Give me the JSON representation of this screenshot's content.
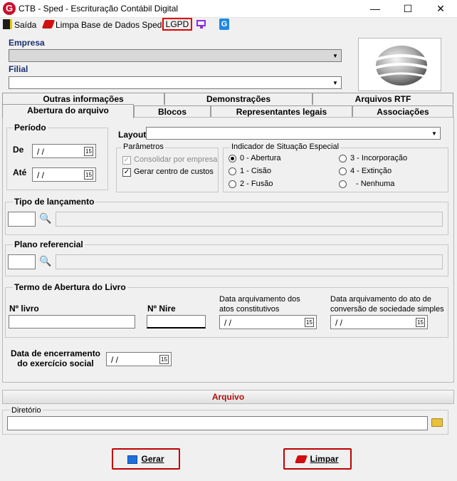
{
  "window": {
    "title": "CTB - Sped - Escrituração Contábil Digital",
    "app_icon": "G",
    "minimize": "—",
    "maximize": "☐",
    "close": "✕"
  },
  "toolbar": {
    "exit_label": "Saída",
    "clear_db_label": "Limpa Base de Dados Sped",
    "lgpd_label": "LGPD"
  },
  "company": {
    "empresa_label": "Empresa",
    "empresa_value": "",
    "filial_label": "Filial",
    "filial_value": ""
  },
  "tabs": {
    "row1": [
      "Outras informações",
      "Demonstrações",
      "Arquivos RTF"
    ],
    "row2": [
      "Abertura do arquivo",
      "Blocos",
      "Representantes legais",
      "Associações"
    ],
    "active": "Abertura do arquivo"
  },
  "periodo": {
    "title": "Período",
    "de_label": "De",
    "de_value": "/ /",
    "ate_label": "Até",
    "ate_value": "/ /"
  },
  "layout": {
    "label": "Layout",
    "value": ""
  },
  "parametros": {
    "title": "Parâmetros",
    "consolidar_label": "Consolidar por empresa",
    "consolidar_checked": true,
    "consolidar_disabled": true,
    "gerar_label": "Gerar centro de custos",
    "gerar_checked": true
  },
  "indicador": {
    "title": "Indicador de Situação Especial",
    "options": [
      "0 - Abertura",
      "1 - Cisão",
      "2 - Fusão",
      "3 - Incorporação",
      "4 - Extinção",
      "- Nenhuma"
    ],
    "selected": "0 - Abertura"
  },
  "tipo_lancamento": {
    "title": "Tipo de lançamento",
    "code": "",
    "description": ""
  },
  "plano_referencial": {
    "title": "Plano referencial",
    "code": "",
    "description": ""
  },
  "termo": {
    "title": "Termo de Abertura do Livro",
    "n_livro_label": "Nº livro",
    "n_livro_value": "",
    "n_nire_label": "Nº Nire",
    "n_nire_value": "",
    "data_arq_atos_label_1": "Data arquivamento dos",
    "data_arq_atos_label_2": "atos constitutivos",
    "data_arq_atos_value": "/ /",
    "data_arq_conv_label_1": "Data arquivamento  do ato de",
    "data_arq_conv_label_2": "conversão de sociedade simples",
    "data_arq_conv_value": "/ /"
  },
  "encerramento": {
    "label_1": "Data de encerramento",
    "label_2": "do exercício social",
    "value": "/ /"
  },
  "arquivo": {
    "section_title": "Arquivo",
    "diretorio_label": "Diretório",
    "diretorio_value": ""
  },
  "buttons": {
    "gerar_label": "Gerar",
    "limpar_label": "Limpar"
  },
  "icons": {
    "calendar": "15",
    "dropdown": "▼",
    "search": "🔍",
    "folder": "📂",
    "check": "✓"
  },
  "colors": {
    "accent_red": "#c00000",
    "label_blue": "#1a2f6e",
    "search_purple": "#8a4fc2"
  }
}
